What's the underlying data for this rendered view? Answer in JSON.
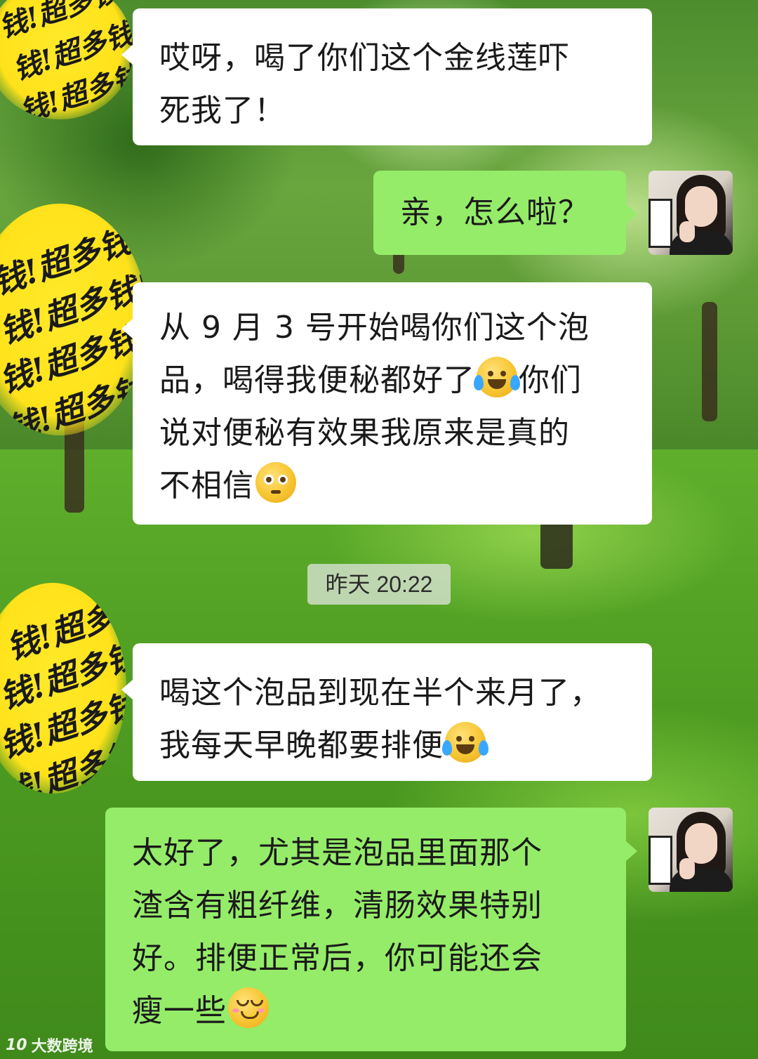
{
  "chat": {
    "messages": [
      {
        "side": "in",
        "lines": [
          "哎呀，喝了你们这个金线莲吓",
          "死我了！"
        ]
      },
      {
        "side": "out",
        "lines": [
          "亲，怎么啦？"
        ]
      },
      {
        "side": "in",
        "lines": [
          "从 9 月 3 号开始喝你们这个泡",
          "品，喝得我便秘都好了",
          "你们",
          "说对便秘有效果我原来是真的",
          "不相信"
        ],
        "emojis": [
          "crying-laugh-icon",
          "pleading-face-icon"
        ]
      },
      {
        "side": "in",
        "lines": [
          "喝这个泡品到现在半个来月了，",
          "我每天早晚都要排便"
        ],
        "emojis": [
          "crying-laugh-icon"
        ]
      },
      {
        "side": "out",
        "lines": [
          "太好了，尤其是泡品里面那个",
          "渣含有粗纤维，清肠效果特别",
          "好。排便正常后，你可能还会",
          "瘦一些"
        ],
        "emojis": [
          "smiling-blush-icon"
        ]
      }
    ],
    "timestamp": "昨天 20:22"
  },
  "stickers": {
    "text": "钱!超多钱!超多"
  },
  "watermark": {
    "logo": "10",
    "text": "大数跨境"
  },
  "colors": {
    "bubble_out": "#95ec69",
    "bubble_in": "#ffffff",
    "sticker": "#ffe21a"
  }
}
